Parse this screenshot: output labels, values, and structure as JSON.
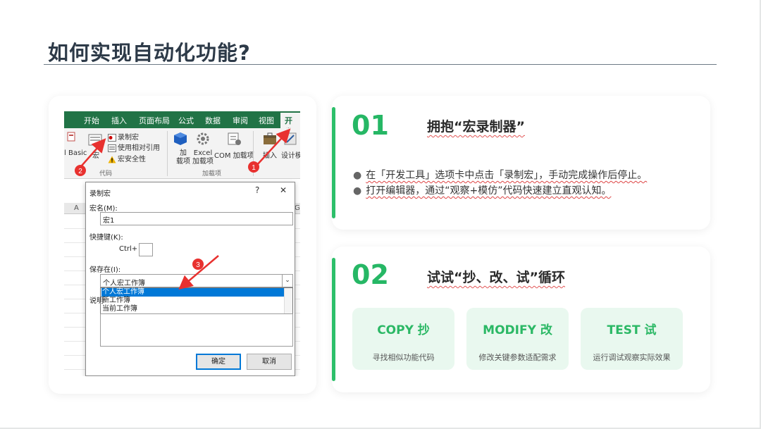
{
  "title": "如何实现自动化功能?",
  "excel": {
    "tabs": [
      "开始",
      "插入",
      "页面布局",
      "公式",
      "数据",
      "审阅",
      "视图",
      "开发"
    ],
    "ribbon": {
      "basic": "l Basic",
      "macro_short": "宏",
      "record_macro": "录制宏",
      "relative_ref": "使用相对引用",
      "macro_security": "宏安全性",
      "group_code": "代码",
      "addins": [
        "加",
        "载项"
      ],
      "excel_addins": [
        "Excel",
        "加载项"
      ],
      "com_addins": "COM 加载项",
      "group_addins": "加载项",
      "insert": "插入",
      "design_mode": "设计模"
    },
    "col_a": "A",
    "col_g": "G",
    "badges": [
      "1",
      "2",
      "3"
    ],
    "dialog": {
      "title": "录制宏",
      "help": "?",
      "close": "✕",
      "name_label": "宏名(M):",
      "name_value": "宏1",
      "shortcut_label": "快捷键(K):",
      "ctrl": "Ctrl+",
      "store_label": "保存在(I):",
      "store_value": "个人宏工作簿",
      "options": [
        "个人宏工作簿",
        "新工作簿",
        "当前工作簿"
      ],
      "desc_label": "说明",
      "ok": "确定",
      "cancel": "取消"
    }
  },
  "section1": {
    "num": "01",
    "title": "拥抱“宏录制器”",
    "bullets": [
      "在「开发工具」选项卡中点击「录制宏」，手动完成操作后停止。",
      "打开编辑器，通过“观察+模仿”代码快速建立直观认知。"
    ]
  },
  "section2": {
    "num": "02",
    "title": "试试“抄、改、试”循环",
    "cards": [
      {
        "heading": "COPY 抄",
        "desc": "寻找相似功能代码"
      },
      {
        "heading": "MODIFY 改",
        "desc": "修改关键参数适配需求"
      },
      {
        "heading": "TEST 试",
        "desc": "运行调试观察实际效果"
      }
    ]
  },
  "colors": {
    "accent": "#26b765",
    "title": "#2d3a48",
    "excel_green": "#217346",
    "selection": "#0078d7",
    "arrow": "#e8312f"
  }
}
